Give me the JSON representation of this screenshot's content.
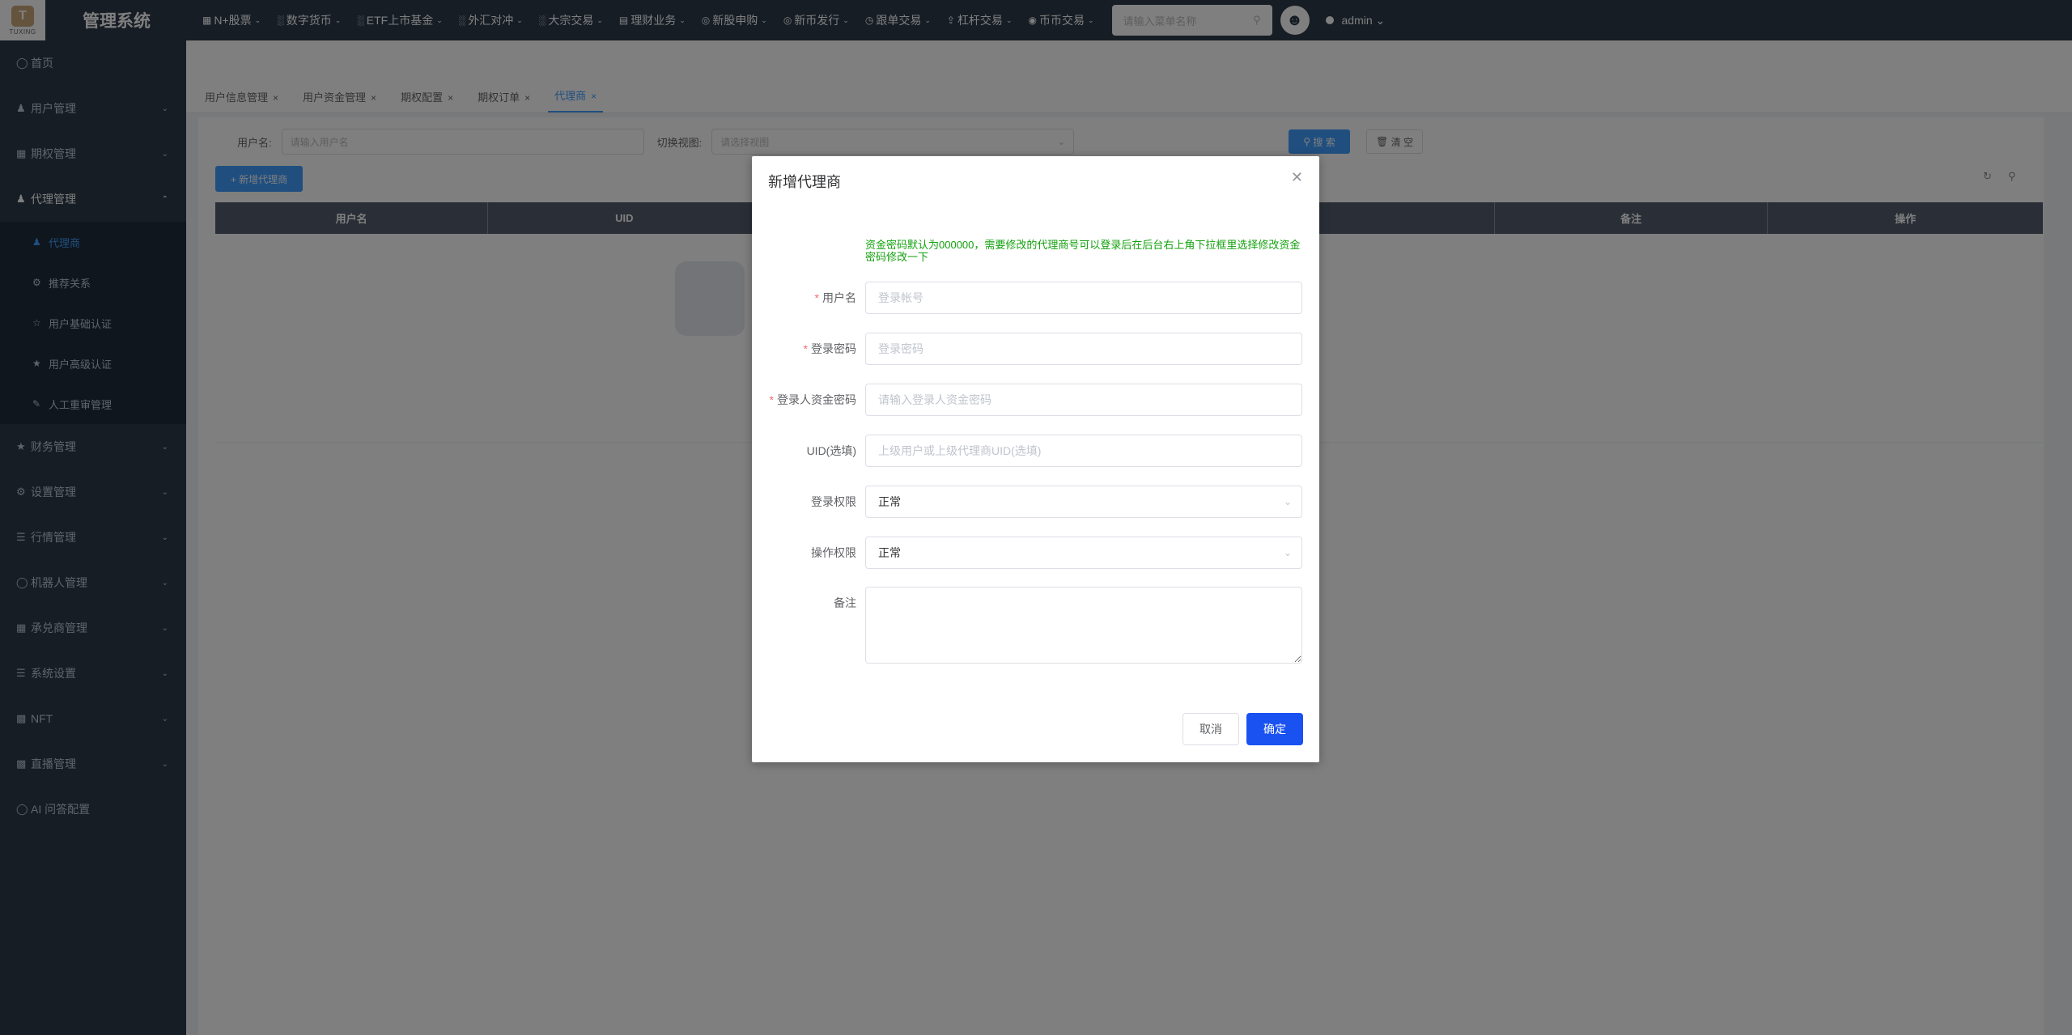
{
  "header": {
    "logo_text": "T",
    "logo_sub": "TUXING",
    "title": "管理系统",
    "nav": [
      {
        "icon": "▦",
        "label": "N+股票"
      },
      {
        "icon": "░",
        "label": "数字货币"
      },
      {
        "icon": "░",
        "label": "ETF上市基金"
      },
      {
        "icon": "░",
        "label": "外汇对冲"
      },
      {
        "icon": "░",
        "label": "大宗交易"
      },
      {
        "icon": "▤",
        "label": "理财业务"
      },
      {
        "icon": "◎",
        "label": "新股申购"
      },
      {
        "icon": "◎",
        "label": "新币发行"
      },
      {
        "icon": "◷",
        "label": "跟单交易"
      },
      {
        "icon": "⇪",
        "label": "杠杆交易"
      },
      {
        "icon": "◉",
        "label": "币币交易"
      }
    ],
    "search_placeholder": "请输入菜单名称",
    "user": "admin"
  },
  "sidebar": {
    "items": [
      {
        "label": "首页"
      },
      {
        "label": "用户管理"
      },
      {
        "label": "期权管理"
      },
      {
        "label": "代理管理"
      },
      {
        "label": "财务管理"
      },
      {
        "label": "设置管理"
      },
      {
        "label": "行情管理"
      },
      {
        "label": "机器人管理"
      },
      {
        "label": "承兑商管理"
      },
      {
        "label": "系统设置"
      },
      {
        "label": "NFT"
      },
      {
        "label": "直播管理"
      },
      {
        "label": "AI 问答配置"
      }
    ],
    "sub_items": [
      {
        "label": "代理商"
      },
      {
        "label": "推荐关系"
      },
      {
        "label": "用户基础认证"
      },
      {
        "label": "用户高级认证"
      },
      {
        "label": "人工重审管理"
      }
    ]
  },
  "tabs": [
    {
      "label": "用户信息管理"
    },
    {
      "label": "用户资金管理"
    },
    {
      "label": "期权配置"
    },
    {
      "label": "期权订单"
    },
    {
      "label": "代理商"
    }
  ],
  "filter": {
    "username_label": "用户名:",
    "username_placeholder": "请输入用户名",
    "view_label": "切换视图:",
    "view_placeholder": "请选择视图",
    "search_btn": "搜 索",
    "clear_btn": "清 空",
    "add_btn": "+ 新增代理商"
  },
  "table": {
    "headers": [
      "用户名",
      "UID",
      "",
      "",
      "备注",
      "操作"
    ]
  },
  "dialog": {
    "title": "新增代理商",
    "notice": "资金密码默认为000000，需要修改的代理商号可以登录后在后台右上角下拉框里选择修改资金密码修改一下",
    "fields": {
      "username": {
        "label": "用户名",
        "placeholder": "登录帐号"
      },
      "password": {
        "label": "登录密码",
        "placeholder": "登录密码"
      },
      "fund_password": {
        "label": "登录人资金密码",
        "placeholder": "请输入登录人资金密码"
      },
      "uid": {
        "label": "UID(选填)",
        "placeholder": "上级用户或上级代理商UID(选填)"
      },
      "login_perm": {
        "label": "登录权限",
        "value": "正常"
      },
      "op_perm": {
        "label": "操作权限",
        "value": "正常"
      },
      "remark": {
        "label": "备注"
      }
    },
    "cancel": "取消",
    "confirm": "确定"
  }
}
